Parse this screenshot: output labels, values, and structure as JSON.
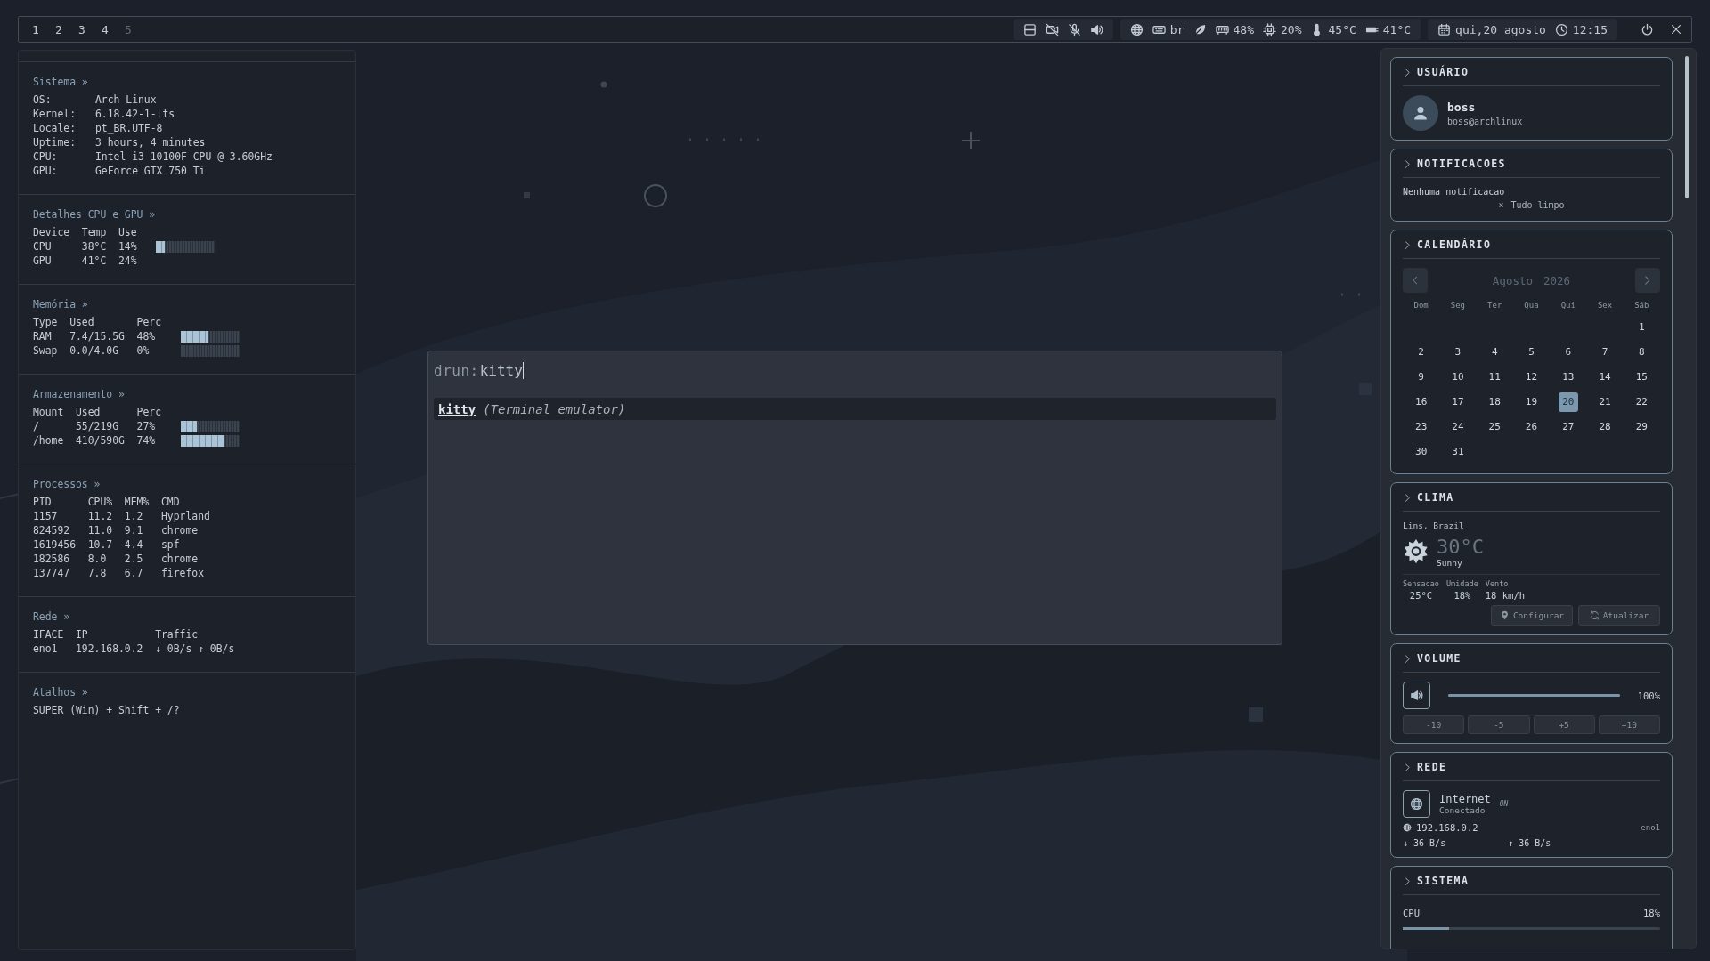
{
  "top_bar": {
    "workspaces": [
      {
        "label": "1",
        "occupied": true
      },
      {
        "label": "2",
        "occupied": true
      },
      {
        "label": "3",
        "occupied": true
      },
      {
        "label": "4",
        "occupied": true
      },
      {
        "label": "5",
        "occupied": false
      }
    ],
    "keyboard_layout": "br",
    "memory": "48%",
    "cpu": "20%",
    "cpu_temp": "45°C",
    "gpu_temp": "41°C",
    "date": "qui,20 agosto",
    "time": "12:15"
  },
  "info_panel": {
    "sections": [
      {
        "title": "Sistema »",
        "kind": "keyvalue",
        "rows": [
          [
            "OS:",
            "Arch Linux"
          ],
          [
            "Kernel:",
            "6.18.42-1-lts"
          ],
          [
            "Locale:",
            "pt_BR.UTF-8"
          ],
          [
            "Uptime:",
            "3 hours, 4 minutes"
          ],
          [
            "CPU:",
            "Intel i3-10100F CPU @ 3.60GHz"
          ],
          [
            "GPU:",
            "GeForce GTX 750 Ti"
          ]
        ]
      },
      {
        "title": "Detalhes CPU e GPU »",
        "kind": "table",
        "columns": [
          "Device",
          "Temp",
          "Use"
        ],
        "rows": [
          {
            "cells": [
              "CPU",
              "38°C",
              "14%"
            ],
            "level": 0.14
          },
          {
            "cells": [
              "GPU",
              "41°C",
              "24%"
            ]
          }
        ]
      },
      {
        "title": "Memória »",
        "kind": "table",
        "columns": [
          "Type",
          "Used",
          "Perc"
        ],
        "rows": [
          {
            "cells": [
              "RAM",
              "7.4/15.5G",
              "48%"
            ],
            "level": 0.48
          },
          {
            "cells": [
              "Swap",
              "0.0/4.0G",
              "0%"
            ],
            "level": 0
          }
        ]
      },
      {
        "title": "Armazenamento »",
        "kind": "table",
        "columns": [
          "Mount",
          "Used",
          "Perc"
        ],
        "rows": [
          {
            "cells": [
              "/",
              "55/219G",
              "27%"
            ],
            "level": 0.27
          },
          {
            "cells": [
              "/home",
              "410/590G",
              "74%"
            ],
            "level": 0.74
          }
        ]
      },
      {
        "title": "Processos »",
        "kind": "table",
        "columns": [
          "PID",
          "CPU%",
          "MEM%",
          "CMD"
        ],
        "rows": [
          {
            "cells": [
              "1157",
              "11.2",
              "1.2",
              "Hyprland"
            ]
          },
          {
            "cells": [
              "824592",
              "11.0",
              "9.1",
              "chrome"
            ]
          },
          {
            "cells": [
              "1619456",
              "10.7",
              "4.4",
              "spf"
            ]
          },
          {
            "cells": [
              "182586",
              "8.0",
              "2.5",
              "chrome"
            ]
          },
          {
            "cells": [
              "137747",
              "7.8",
              "6.7",
              "firefox"
            ]
          }
        ]
      },
      {
        "title": "Rede »",
        "kind": "table",
        "columns": [
          "IFACE",
          "IP",
          "Traffic"
        ],
        "rows": [
          {
            "cells": [
              "eno1",
              "192.168.0.2",
              "↓ 0B/s ↑ 0B/s"
            ]
          }
        ]
      },
      {
        "title": "Atalhos »",
        "kind": "lines",
        "lines": [
          "SUPER (Win) + Shift + /?"
        ]
      }
    ]
  },
  "launcher": {
    "prompt": "drun:",
    "query": "kitty",
    "results": [
      {
        "name": "kitty",
        "description": "(Terminal emulator)",
        "selected": true
      }
    ]
  },
  "side_panel": {
    "user": {
      "title": "USUÁRIO",
      "name": "boss",
      "handle": "boss@archlinux"
    },
    "notifications": {
      "title": "NOTIFICACOES",
      "empty_text": "Nenhuma notificacao",
      "clear_icon": "×",
      "clear_button": "Tudo limpo"
    },
    "calendar": {
      "title": "CALENDÁRIO",
      "month": "Agosto",
      "year": "2026",
      "weekdays": [
        "Dom",
        "Seg",
        "Ter",
        "Qua",
        "Qui",
        "Sex",
        "Sáb"
      ],
      "weeks": [
        {
          "kind": "first",
          "days": [
            {
              "day": "1",
              "selected": false
            }
          ]
        },
        {
          "kind": "full",
          "days": [
            {
              "day": "2",
              "selected": false
            },
            {
              "day": "3",
              "selected": false
            },
            {
              "day": "4",
              "selected": false
            },
            {
              "day": "5",
              "selected": false
            },
            {
              "day": "6",
              "selected": false
            },
            {
              "day": "7",
              "selected": false
            },
            {
              "day": "8",
              "selected": false
            }
          ]
        },
        {
          "kind": "full",
          "days": [
            {
              "day": "9",
              "selected": false
            },
            {
              "day": "10",
              "selected": false
            },
            {
              "day": "11",
              "selected": false
            },
            {
              "day": "12",
              "selected": false
            },
            {
              "day": "13",
              "selected": false
            },
            {
              "day": "14",
              "selected": false
            },
            {
              "day": "15",
              "selected": false
            }
          ]
        },
        {
          "kind": "full",
          "days": [
            {
              "day": "16",
              "selected": false
            },
            {
              "day": "17",
              "selected": false
            },
            {
              "day": "18",
              "selected": false
            },
            {
              "day": "19",
              "selected": false
            },
            {
              "day": "20",
              "selected": true
            },
            {
              "day": "21",
              "selected": false
            },
            {
              "day": "22",
              "selected": false
            }
          ]
        },
        {
          "kind": "full",
          "days": [
            {
              "day": "23",
              "selected": false
            },
            {
              "day": "24",
              "selected": false
            },
            {
              "day": "25",
              "selected": false
            },
            {
              "day": "26",
              "selected": false
            },
            {
              "day": "27",
              "selected": false
            },
            {
              "day": "28",
              "selected": false
            },
            {
              "day": "29",
              "selected": false
            }
          ]
        },
        {
          "kind": "last",
          "days": [
            {
              "day": "30",
              "selected": false
            },
            {
              "day": "31",
              "selected": false
            }
          ]
        }
      ]
    },
    "weather": {
      "title": "CLIMA",
      "location": "Lins, Brazil",
      "temperature": "30°C",
      "condition": "Sunny",
      "stats": [
        {
          "label": "Sensacao",
          "value": "25°C"
        },
        {
          "label": "Umidade",
          "value": "18%"
        },
        {
          "label": "Vento",
          "value": "18 km/h"
        }
      ],
      "buttons": [
        {
          "kind": "location",
          "label": "Configurar",
          "disabled": true
        },
        {
          "kind": "refresh",
          "label": "Atualizar",
          "disabled": true
        }
      ]
    },
    "volume": {
      "title": "VOLUME",
      "level": 1.0,
      "reading": "100%",
      "steps": [
        {
          "label": "-10",
          "disabled": true
        },
        {
          "label": "-5",
          "disabled": true
        },
        {
          "label": "+5",
          "disabled": true
        },
        {
          "label": "+10",
          "disabled": true
        }
      ]
    },
    "network": {
      "title": "REDE",
      "name": "Internet",
      "status": "Conectado",
      "badge": "ON",
      "ip": "192.168.0.2",
      "iface": "eno1",
      "down": "↓ 36 B/s",
      "up": "↑ 36 B/s"
    },
    "system": {
      "title": "SISTEMA",
      "meters": [
        {
          "label": "CPU",
          "reading": "18%",
          "level": 0.18
        }
      ]
    }
  }
}
